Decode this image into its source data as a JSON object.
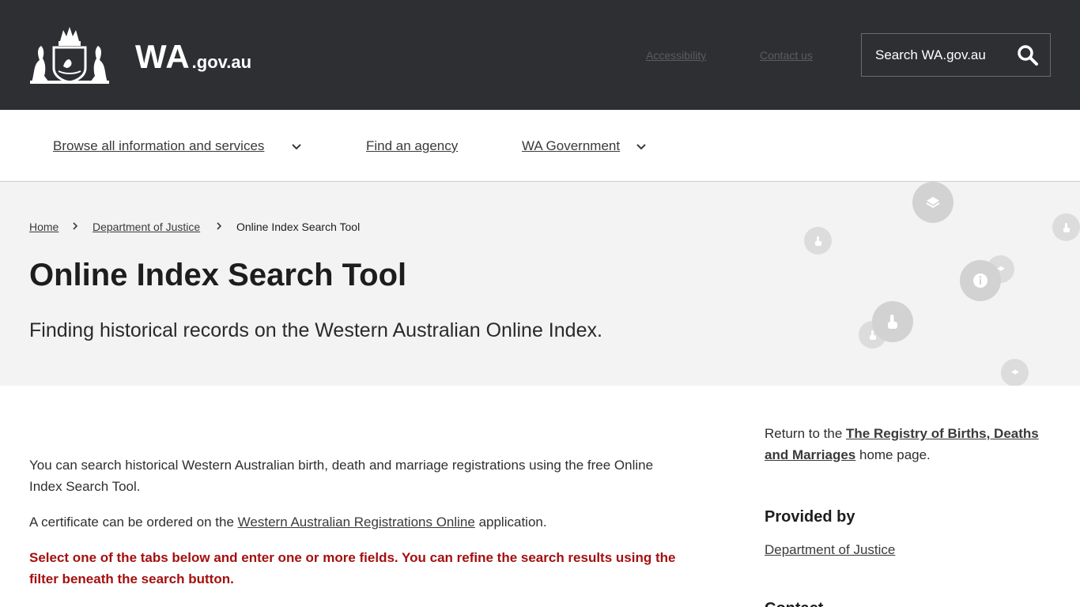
{
  "header": {
    "logo_main": "WA",
    "logo_suffix": ".gov.au",
    "utility_links": [
      "Accessibility",
      "Contact us"
    ],
    "search_placeholder": "Search WA.gov.au"
  },
  "nav": {
    "items": [
      {
        "label": "Browse all information and services",
        "has_dropdown": true
      },
      {
        "label": "Find an agency",
        "has_dropdown": false
      },
      {
        "label": "WA Government",
        "has_dropdown": true
      }
    ]
  },
  "breadcrumb": [
    "Home",
    "Department of Justice",
    "Online Index Search Tool"
  ],
  "hero": {
    "title": "Online Index Search Tool",
    "subtitle": "Finding historical records on the Western Australian Online Index."
  },
  "content": {
    "para1": "You can search historical Western Australian birth, death and marriage registrations using the free Online Index Search Tool.",
    "para2_before": "A certificate can be ordered on the ",
    "para2_link": "Western Australian Registrations Online",
    "para2_after": " application.",
    "alert": "Select one of the tabs below and enter one or more fields. You can refine the search results using the filter beneath the search button."
  },
  "sidebar": {
    "return_before": "Return to the ",
    "return_link": "The Registry of Births, Deaths and Marriages",
    "return_after": " home page.",
    "provided_by_heading": "Provided by",
    "provided_by_link": "Department of Justice",
    "contact_heading": "Contact"
  },
  "colors": {
    "header_bg": "#2e2f33",
    "hero_bg": "#f3f3f3",
    "alert_text": "#a3100f"
  }
}
